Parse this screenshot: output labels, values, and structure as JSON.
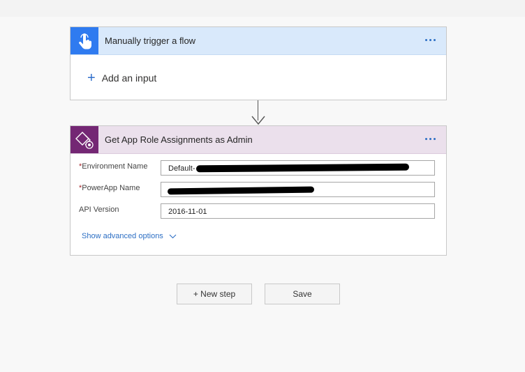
{
  "trigger_card": {
    "title": "Manually trigger a flow",
    "icon": "hand-pointer-icon",
    "add_input_label": "Add an input"
  },
  "action_card": {
    "title": "Get App Role Assignments as Admin",
    "icon": "powerapps-admin-icon",
    "fields": [
      {
        "label": "Environment Name",
        "required": true,
        "value": "Default-"
      },
      {
        "label": "PowerApp Name",
        "required": true,
        "value": ""
      },
      {
        "label": "API Version",
        "required": false,
        "value": "2016-11-01"
      }
    ],
    "advanced_label": "Show advanced options"
  },
  "buttons": {
    "new_step": "+ New step",
    "save": "Save"
  },
  "colors": {
    "trigger_accent": "#2f7bf0",
    "trigger_header": "#d9e9fb",
    "action_accent": "#742774",
    "action_header": "#ebe0ec",
    "link": "#2d6fc4"
  }
}
